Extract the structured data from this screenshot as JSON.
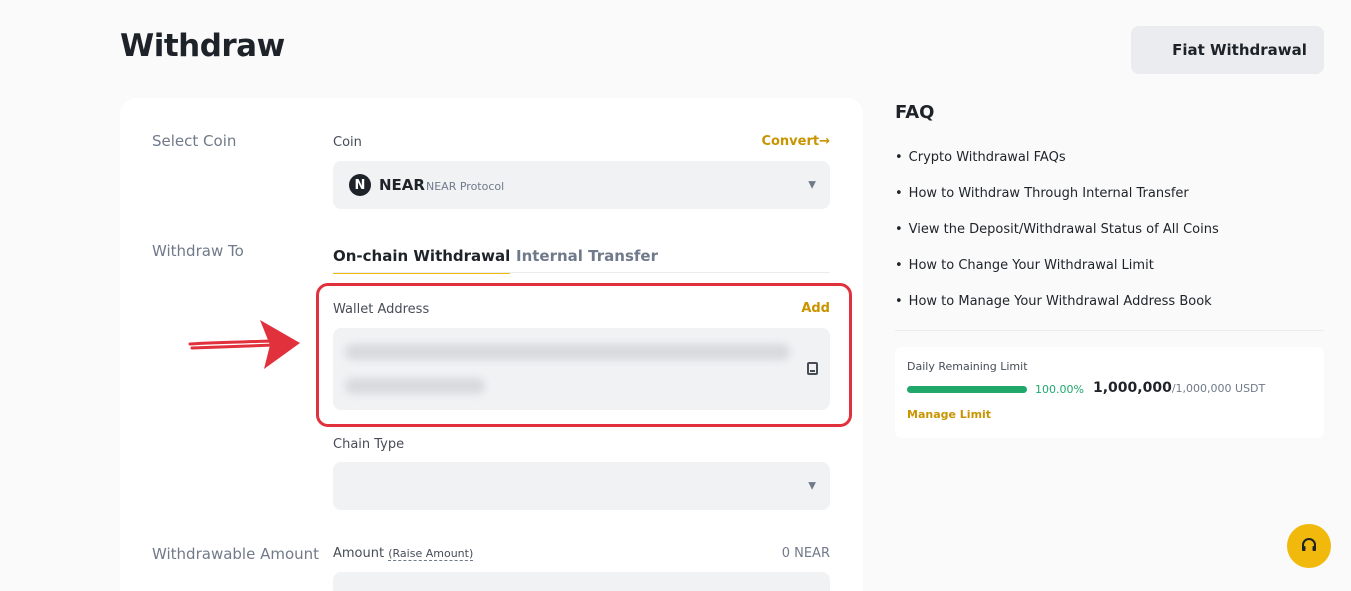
{
  "header": {
    "title": "Withdraw",
    "fiat_button": "Fiat Withdrawal"
  },
  "form": {
    "select_coin_label": "Select Coin",
    "coin_field_label": "Coin",
    "convert_link": "Convert→",
    "coin_icon_letter": "N",
    "coin_symbol": "NEAR",
    "coin_name": "NEAR Protocol",
    "withdraw_to_label": "Withdraw To",
    "tabs": [
      {
        "label": "On-chain Withdrawal",
        "active": true
      },
      {
        "label": "Internal Transfer",
        "active": false
      }
    ],
    "wallet_address_label": "Wallet Address",
    "add_link": "Add",
    "chain_type_label": "Chain Type",
    "withdrawable_amount_label": "Withdrawable Amount",
    "amount_label": "Amount",
    "raise_amount_link": "(Raise Amount)",
    "amount_available": "0 NEAR"
  },
  "faq": {
    "title": "FAQ",
    "items": [
      "Crypto Withdrawal FAQs",
      "How to Withdraw Through Internal Transfer",
      "View the Deposit/Withdrawal Status of All Coins",
      "How to Change Your Withdrawal Limit",
      "How to Manage Your Withdrawal Address Book"
    ]
  },
  "limit": {
    "label": "Daily Remaining Limit",
    "percent_text": "100.00%",
    "percent_value": 1.0,
    "remaining": "1,000,000",
    "total": "/1,000,000 USDT",
    "manage_link": "Manage Limit"
  },
  "colors": {
    "accent": "#f0b90b",
    "link": "#c99400",
    "highlight": "#e0313d",
    "progress": "#20a86b"
  },
  "icons": {
    "caret": "▼",
    "support": "headset-icon",
    "address_book": "address-book-icon"
  }
}
